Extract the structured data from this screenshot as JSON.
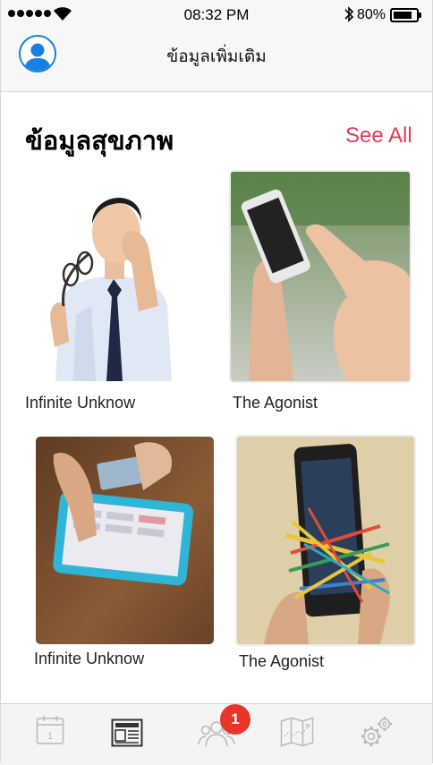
{
  "status_bar": {
    "time": "08:32 PM",
    "battery": "80%"
  },
  "nav": {
    "title": "ข้อมูลเพิ่มเติม",
    "avatar_icon": "user-avatar-icon"
  },
  "section": {
    "title": "ข้อมูลสุขภาพ",
    "see_all": "See All"
  },
  "cards": [
    {
      "label": "Infinite Unknow",
      "image": "man-rubbing-eyes-with-glasses-photo"
    },
    {
      "label": "The Agonist",
      "image": "hands-holding-smartphone-photo"
    },
    {
      "label": "Infinite Unknow",
      "image": "hands-using-tablet-photo"
    },
    {
      "label": "The Agonist",
      "image": "phone-wrapped-in-rubber-bands-photo"
    }
  ],
  "tabbar": {
    "tabs": [
      "calendar-icon",
      "news-icon",
      "people-icon",
      "map-icon",
      "settings-gears-icon"
    ],
    "calendar_day": "1",
    "badge": "1"
  },
  "colors": {
    "accent": "#e03a5c",
    "badge": "#e8352a",
    "avatar_blue": "#1a7fe0"
  }
}
